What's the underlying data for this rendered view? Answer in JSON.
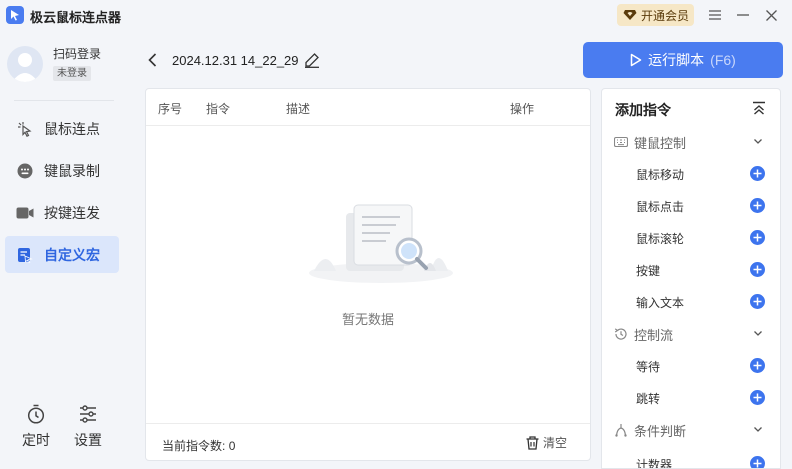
{
  "app": {
    "title": "极云鼠标连点器",
    "vip_label": "开通会员"
  },
  "user": {
    "login_label": "扫码登录",
    "status_badge": "未登录"
  },
  "nav": [
    {
      "label": "鼠标连点",
      "icon": "cursor-click-icon"
    },
    {
      "label": "键鼠录制",
      "icon": "record-icon"
    },
    {
      "label": "按键连发",
      "icon": "camera-icon"
    },
    {
      "label": "自定义宏",
      "icon": "macro-icon",
      "active": true
    }
  ],
  "bottom_tools": [
    {
      "label": "定时",
      "icon": "timer-icon"
    },
    {
      "label": "设置",
      "icon": "settings-sliders-icon"
    }
  ],
  "script": {
    "name": "2024.12.31 14_22_29"
  },
  "run_button": {
    "label": "运行脚本",
    "shortcut": "(F6)"
  },
  "table": {
    "columns": [
      "序号",
      "指令",
      "描述",
      "操作"
    ],
    "empty_text": "暂无数据",
    "count_label": "当前指令数:",
    "count": "0",
    "clear_label": "清空"
  },
  "commands": {
    "title": "添加指令",
    "categories": [
      {
        "label": "键鼠控制",
        "icon": "keyboard-icon",
        "items": [
          "鼠标移动",
          "鼠标点击",
          "鼠标滚轮",
          "按键",
          "输入文本"
        ]
      },
      {
        "label": "控制流",
        "icon": "history-icon",
        "items": [
          "等待",
          "跳转"
        ]
      },
      {
        "label": "条件判断",
        "icon": "branch-icon",
        "items": [
          "计数器"
        ]
      }
    ]
  },
  "colors": {
    "accent": "#4a7cf0",
    "active_bg": "#dbe6fb",
    "vip_bg": "#f6e7c6"
  }
}
